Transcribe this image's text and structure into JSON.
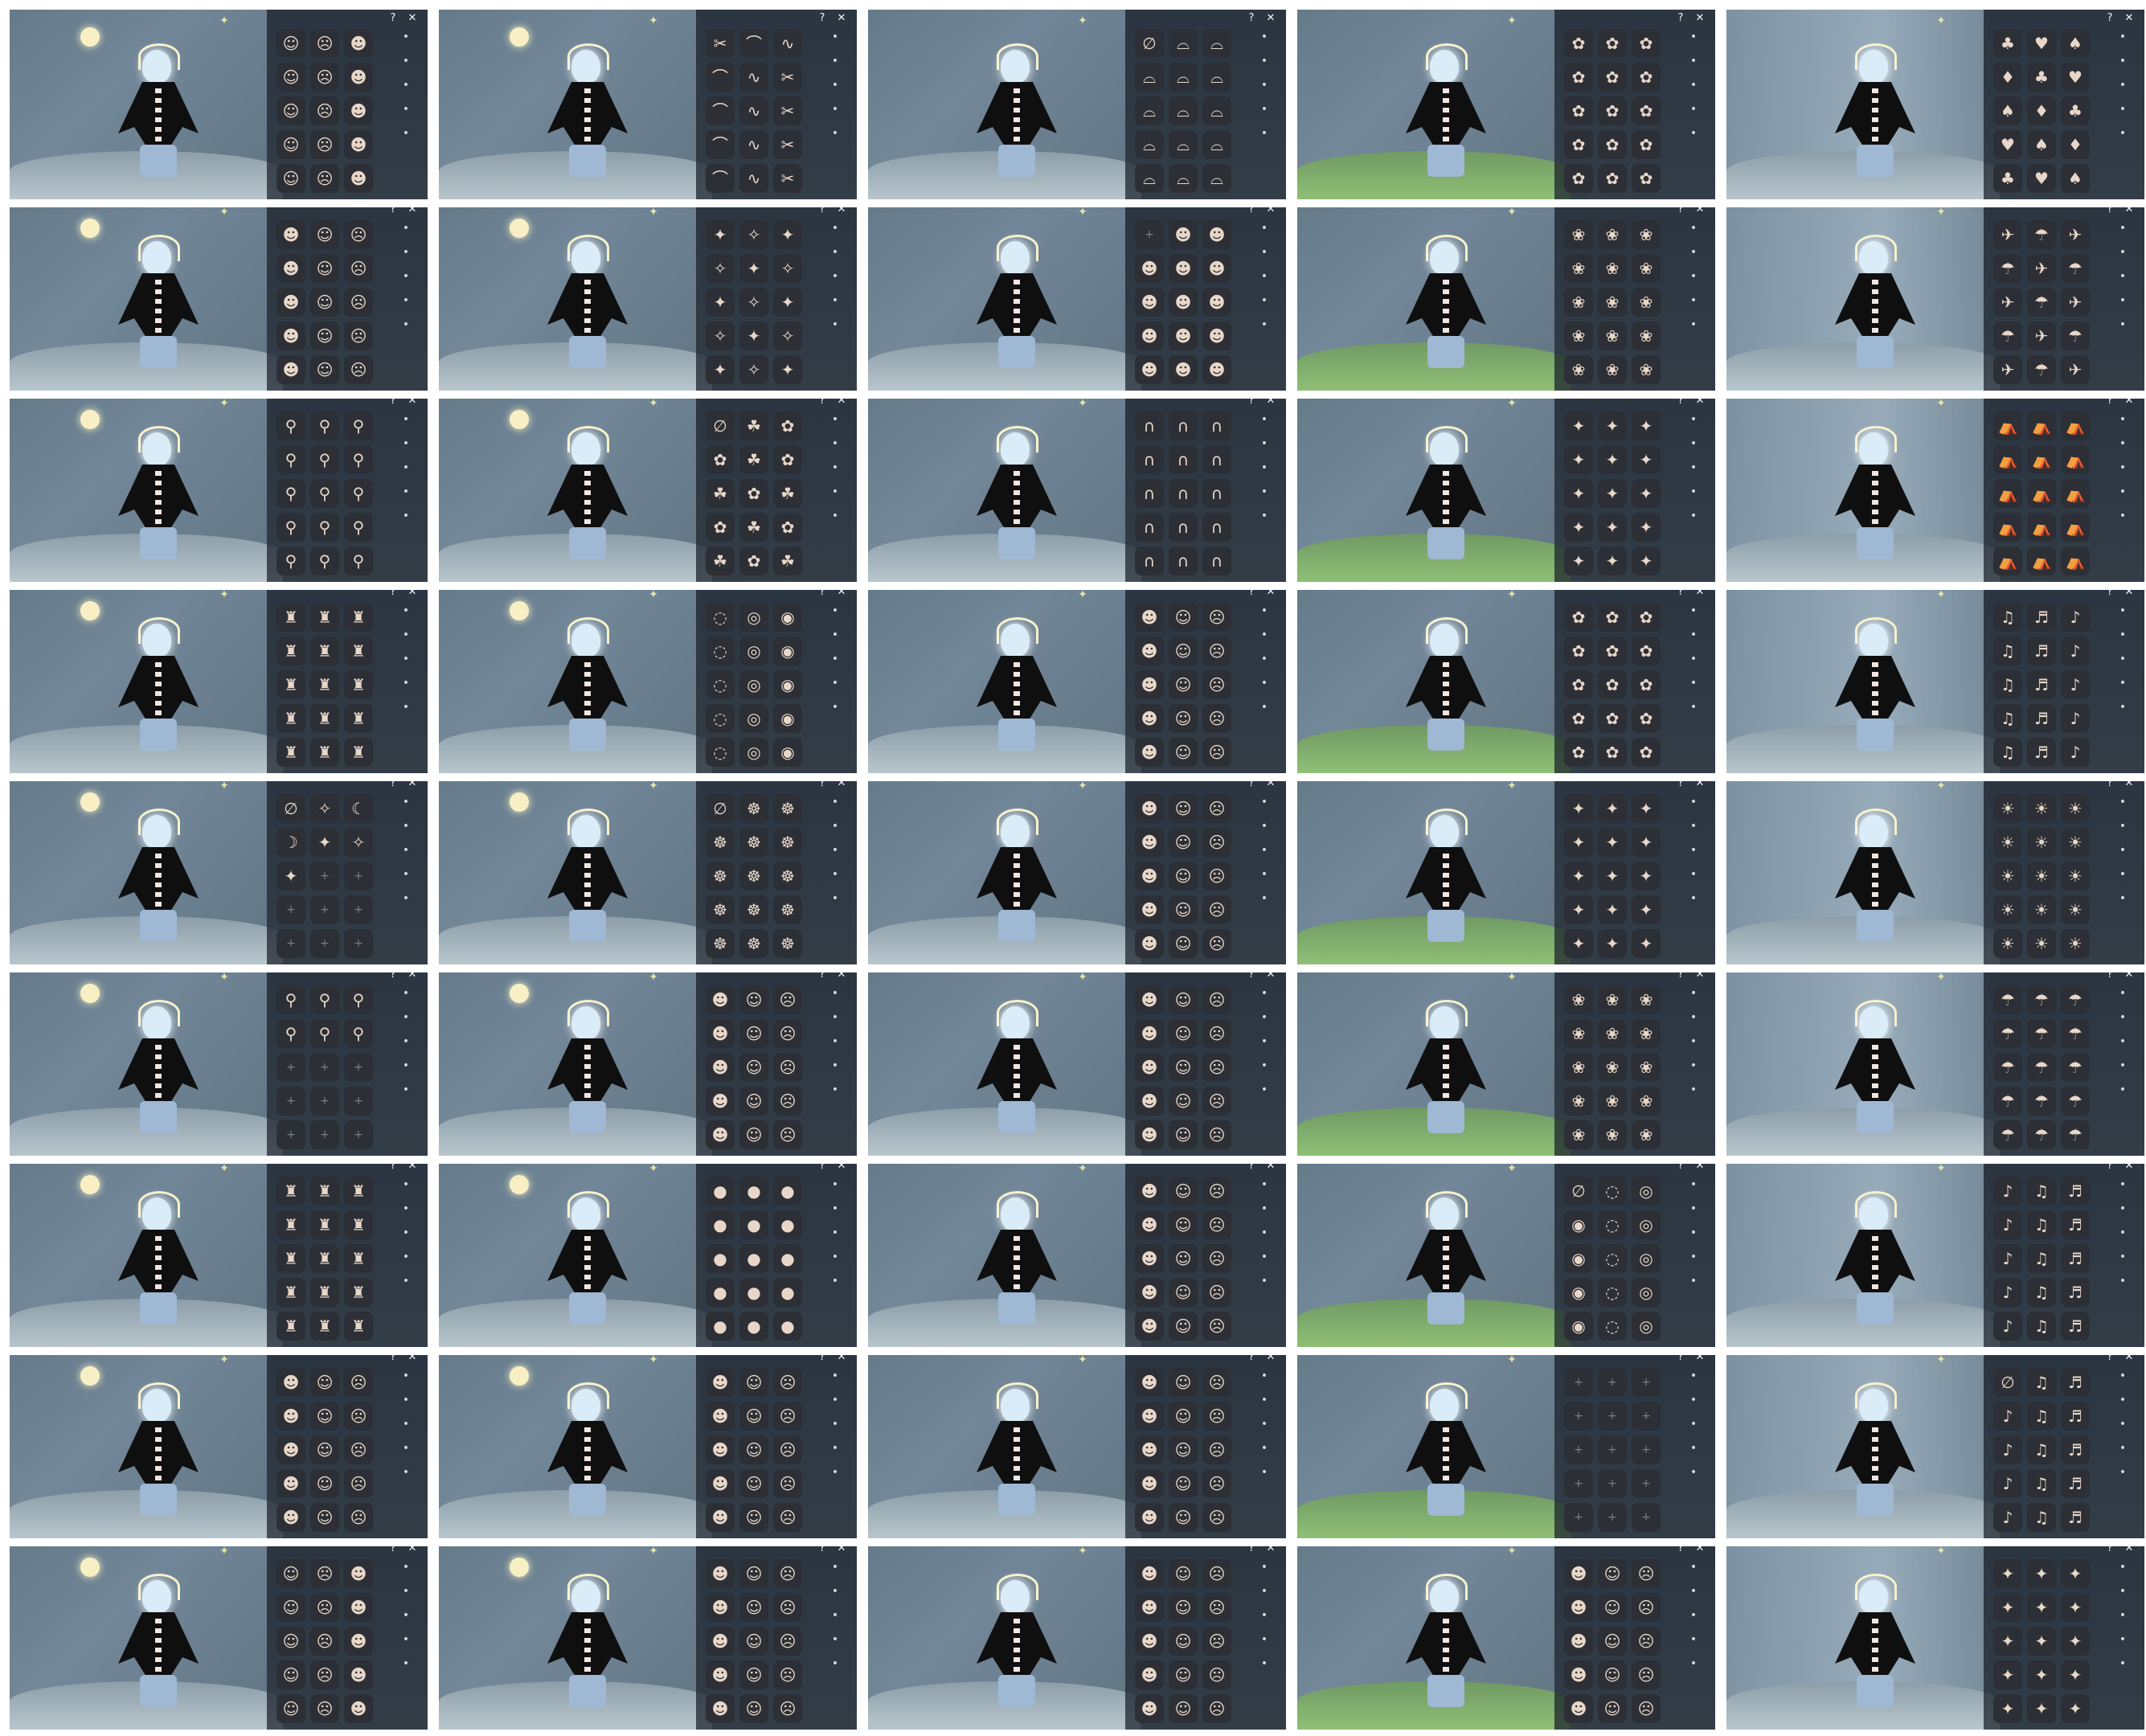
{
  "grid": {
    "rows": 9,
    "cols": 5
  },
  "labels": {
    "help": "?",
    "close": "✕"
  },
  "palette": {
    "panel": "#1f2630",
    "slot": "#2c2f35",
    "accent": "#f8f0c4"
  },
  "categories": [
    "face-icon",
    "hair-icon",
    "cape-icon",
    "prop-icon",
    "emote-icon"
  ],
  "columns": [
    {
      "name": "masks",
      "tiles": [
        {
          "icons": [
            "☺",
            "☹",
            "☻",
            "☺",
            "☹",
            "☻",
            "☺",
            "☹",
            "☻",
            "☺",
            "☹",
            "☻",
            "☺",
            "☹",
            "☻"
          ]
        },
        {
          "icons": [
            "☻",
            "☺",
            "☹",
            "☻",
            "☺",
            "☹",
            "☻",
            "☺",
            "☹",
            "☻",
            "☺",
            "☹",
            "☻",
            "☺",
            "☹"
          ]
        },
        {
          "icons": [
            "⚲",
            "⚲",
            "⚲",
            "⚲",
            "⚲",
            "⚲",
            "⚲",
            "⚲",
            "⚲",
            "⚲",
            "⚲",
            "⚲",
            "⚲",
            "⚲",
            "⚲"
          ]
        },
        {
          "icons": [
            "♜",
            "♜",
            "♜",
            "♜",
            "♜",
            "♜",
            "♜",
            "♜",
            "♜",
            "♜",
            "♜",
            "♜",
            "♜",
            "♜",
            "♜"
          ]
        },
        {
          "icons": [
            "∅",
            "✧",
            "☾",
            "☽",
            "✦",
            "✧",
            "✦",
            "+",
            "+",
            "+",
            "+",
            "+",
            "+",
            "+",
            "+"
          ]
        },
        {
          "icons": [
            "⚲",
            "⚲",
            "⚲",
            "⚲",
            "⚲",
            "⚲",
            "+",
            "+",
            "+",
            "+",
            "+",
            "+",
            "+",
            "+",
            "+"
          ]
        },
        {
          "icons": [
            "♜",
            "♜",
            "♜",
            "♜",
            "♜",
            "♜",
            "♜",
            "♜",
            "♜",
            "♜",
            "♜",
            "♜",
            "♜",
            "♜",
            "♜"
          ]
        },
        {
          "icons": [
            "☻",
            "☺",
            "☹",
            "☻",
            "☺",
            "☹",
            "☻",
            "☺",
            "☹",
            "☻",
            "☺",
            "☹",
            "☻",
            "☺",
            "☹"
          ]
        },
        {
          "icons": [
            "☺",
            "☹",
            "☻",
            "☺",
            "☹",
            "☻",
            "☺",
            "☹",
            "☻",
            "☺",
            "☹",
            "☻",
            "☺",
            "☹",
            "☻"
          ]
        }
      ]
    },
    {
      "name": "hair",
      "tiles": [
        {
          "icons": [
            "✂",
            "⌒",
            "∿",
            "⌒",
            "∿",
            "✂",
            "⌒",
            "∿",
            "✂",
            "⌒",
            "∿",
            "✂",
            "⌒",
            "∿",
            "✂"
          ]
        },
        {
          "icons": [
            "✦",
            "✧",
            "✦",
            "✧",
            "✦",
            "✧",
            "✦",
            "✧",
            "✦",
            "✧",
            "✦",
            "✧",
            "✦",
            "✧",
            "✦"
          ]
        },
        {
          "icons": [
            "∅",
            "☘",
            "✿",
            "✿",
            "☘",
            "✿",
            "☘",
            "✿",
            "☘",
            "✿",
            "☘",
            "✿",
            "☘",
            "✿",
            "☘"
          ]
        },
        {
          "icons": [
            "◌",
            "◎",
            "◉",
            "◌",
            "◎",
            "◉",
            "◌",
            "◎",
            "◉",
            "◌",
            "◎",
            "◉",
            "◌",
            "◎",
            "◉"
          ]
        },
        {
          "icons": [
            "∅",
            "☸",
            "☸",
            "☸",
            "☸",
            "☸",
            "☸",
            "☸",
            "☸",
            "☸",
            "☸",
            "☸",
            "☸",
            "☸",
            "☸"
          ]
        },
        {
          "icons": [
            "☻",
            "☺",
            "☹",
            "☻",
            "☺",
            "☹",
            "☻",
            "☺",
            "☹",
            "☻",
            "☺",
            "☹",
            "☻",
            "☺",
            "☹"
          ]
        },
        {
          "icons": [
            "●",
            "●",
            "●",
            "●",
            "●",
            "●",
            "●",
            "●",
            "●",
            "●",
            "●",
            "●",
            "●",
            "●",
            "●"
          ]
        },
        {
          "icons": [
            "☻",
            "☺",
            "☹",
            "☻",
            "☺",
            "☹",
            "☻",
            "☺",
            "☹",
            "☻",
            "☺",
            "☹",
            "☻",
            "☺",
            "☹"
          ]
        },
        {
          "icons": [
            "☻",
            "☺",
            "☹",
            "☻",
            "☺",
            "☹",
            "☻",
            "☺",
            "☹",
            "☻",
            "☺",
            "☹",
            "☻",
            "☺",
            "☹"
          ]
        }
      ]
    },
    {
      "name": "hats",
      "tiles": [
        {
          "icons": [
            "∅",
            "⌓",
            "⌓",
            "⌓",
            "⌓",
            "⌓",
            "⌓",
            "⌓",
            "⌓",
            "⌓",
            "⌓",
            "⌓",
            "⌓",
            "⌓",
            "⌓"
          ]
        },
        {
          "icons": [
            "+",
            "☻",
            "☻",
            "☻",
            "☻",
            "☻",
            "☻",
            "☻",
            "☻",
            "☻",
            "☻",
            "☻",
            "☻",
            "☻",
            "☻"
          ]
        },
        {
          "icons": [
            "∩",
            "∩",
            "∩",
            "∩",
            "∩",
            "∩",
            "∩",
            "∩",
            "∩",
            "∩",
            "∩",
            "∩",
            "∩",
            "∩",
            "∩"
          ]
        },
        {
          "icons": [
            "☻",
            "☺",
            "☹",
            "☻",
            "☺",
            "☹",
            "☻",
            "☺",
            "☹",
            "☻",
            "☺",
            "☹",
            "☻",
            "☺",
            "☹"
          ]
        },
        {
          "icons": [
            "☻",
            "☺",
            "☹",
            "☻",
            "☺",
            "☹",
            "☻",
            "☺",
            "☹",
            "☻",
            "☺",
            "☹",
            "☻",
            "☺",
            "☹"
          ]
        },
        {
          "icons": [
            "☻",
            "☺",
            "☹",
            "☻",
            "☺",
            "☹",
            "☻",
            "☺",
            "☹",
            "☻",
            "☺",
            "☹",
            "☻",
            "☺",
            "☹"
          ]
        },
        {
          "icons": [
            "☻",
            "☺",
            "☹",
            "☻",
            "☺",
            "☹",
            "☻",
            "☺",
            "☹",
            "☻",
            "☺",
            "☹",
            "☻",
            "☺",
            "☹"
          ]
        },
        {
          "icons": [
            "☻",
            "☺",
            "☹",
            "☻",
            "☺",
            "☹",
            "☻",
            "☺",
            "☹",
            "☻",
            "☺",
            "☹",
            "☻",
            "☺",
            "☹"
          ]
        },
        {
          "icons": [
            "☻",
            "☺",
            "☹",
            "☻",
            "☺",
            "☹",
            "☻",
            "☺",
            "☹",
            "☻",
            "☺",
            "☹",
            "☻",
            "☺",
            "☹"
          ]
        }
      ]
    },
    {
      "name": "capes",
      "tiles": [
        {
          "icons": [
            "✿",
            "✿",
            "✿",
            "✿",
            "✿",
            "✿",
            "✿",
            "✿",
            "✿",
            "✿",
            "✿",
            "✿",
            "✿",
            "✿",
            "✿"
          ]
        },
        {
          "icons": [
            "❀",
            "❀",
            "❀",
            "❀",
            "❀",
            "❀",
            "❀",
            "❀",
            "❀",
            "❀",
            "❀",
            "❀",
            "❀",
            "❀",
            "❀"
          ]
        },
        {
          "icons": [
            "✦",
            "✦",
            "✦",
            "✦",
            "✦",
            "✦",
            "✦",
            "✦",
            "✦",
            "✦",
            "✦",
            "✦",
            "✦",
            "✦",
            "✦"
          ]
        },
        {
          "icons": [
            "✿",
            "✿",
            "✿",
            "✿",
            "✿",
            "✿",
            "✿",
            "✿",
            "✿",
            "✿",
            "✿",
            "✿",
            "✿",
            "✿",
            "✿"
          ]
        },
        {
          "icons": [
            "✦",
            "✦",
            "✦",
            "✦",
            "✦",
            "✦",
            "✦",
            "✦",
            "✦",
            "✦",
            "✦",
            "✦",
            "✦",
            "✦",
            "✦"
          ]
        },
        {
          "icons": [
            "❀",
            "❀",
            "❀",
            "❀",
            "❀",
            "❀",
            "❀",
            "❀",
            "❀",
            "❀",
            "❀",
            "❀",
            "❀",
            "❀",
            "❀"
          ]
        },
        {
          "icons": [
            "∅",
            "◌",
            "◎",
            "◉",
            "◌",
            "◎",
            "◉",
            "◌",
            "◎",
            "◉",
            "◌",
            "◎",
            "◉",
            "◌",
            "◎"
          ]
        },
        {
          "icons": [
            "+",
            "+",
            "+",
            "+",
            "+",
            "+",
            "+",
            "+",
            "+",
            "+",
            "+",
            "+",
            "+",
            "+",
            "+"
          ]
        },
        {
          "icons": [
            "☻",
            "☺",
            "☹",
            "☻",
            "☺",
            "☹",
            "☻",
            "☺",
            "☹",
            "☻",
            "☺",
            "☹",
            "☻",
            "☺",
            "☹"
          ]
        }
      ]
    },
    {
      "name": "props",
      "tiles": [
        {
          "icons": [
            "♣",
            "♥",
            "♠",
            "♦",
            "♣",
            "♥",
            "♠",
            "♦",
            "♣",
            "♥",
            "♠",
            "♦",
            "♣",
            "♥",
            "♠"
          ]
        },
        {
          "icons": [
            "✈",
            "☂",
            "✈",
            "☂",
            "✈",
            "☂",
            "✈",
            "☂",
            "✈",
            "☂",
            "✈",
            "☂",
            "✈",
            "☂",
            "✈"
          ]
        },
        {
          "icons": [
            "⛺",
            "⛺",
            "⛺",
            "⛺",
            "⛺",
            "⛺",
            "⛺",
            "⛺",
            "⛺",
            "⛺",
            "⛺",
            "⛺",
            "⛺",
            "⛺",
            "⛺"
          ]
        },
        {
          "icons": [
            "♫",
            "♬",
            "♪",
            "♫",
            "♬",
            "♪",
            "♫",
            "♬",
            "♪",
            "♫",
            "♬",
            "♪",
            "♫",
            "♬",
            "♪"
          ]
        },
        {
          "icons": [
            "☀",
            "☀",
            "☀",
            "☀",
            "☀",
            "☀",
            "☀",
            "☀",
            "☀",
            "☀",
            "☀",
            "☀",
            "☀",
            "☀",
            "☀"
          ]
        },
        {
          "icons": [
            "☂",
            "☂",
            "☂",
            "☂",
            "☂",
            "☂",
            "☂",
            "☂",
            "☂",
            "☂",
            "☂",
            "☂",
            "☂",
            "☂",
            "☂"
          ]
        },
        {
          "icons": [
            "♪",
            "♫",
            "♬",
            "♪",
            "♫",
            "♬",
            "♪",
            "♫",
            "♬",
            "♪",
            "♫",
            "♬",
            "♪",
            "♫",
            "♬"
          ]
        },
        {
          "icons": [
            "∅",
            "♫",
            "♬",
            "♪",
            "♫",
            "♬",
            "♪",
            "♫",
            "♬",
            "♪",
            "♫",
            "♬",
            "♪",
            "♫",
            "♬"
          ]
        },
        {
          "icons": [
            "✦",
            "✦",
            "✦",
            "✦",
            "✦",
            "✦",
            "✦",
            "✦",
            "✦",
            "✦",
            "✦",
            "✦",
            "✦",
            "✦",
            "✦"
          ]
        }
      ]
    }
  ]
}
